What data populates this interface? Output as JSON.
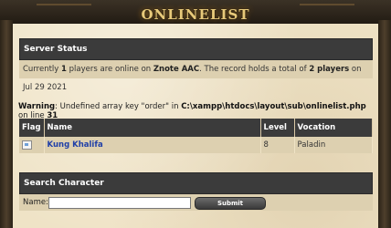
{
  "window": {
    "title": "ONLINELIST"
  },
  "server_status": {
    "heading": "Server Status",
    "text_1": "Currently ",
    "players_count": "1",
    "text_2": " players are online on ",
    "server_name": "Znote AAC",
    "text_3": ". The record holds a total of ",
    "record": "2 players",
    "text_4": " on Jul 29 2021"
  },
  "warning": {
    "label": "Warning",
    "text_1": ": Undefined array key \"order\" in ",
    "path": "C:\\xampp\\htdocs\\layout\\sub\\onlinelist.php",
    "text_2": " on line ",
    "line": "31"
  },
  "online_table": {
    "headers": [
      "Flag",
      "Name",
      "Level",
      "Vocation"
    ],
    "rows": [
      {
        "name": "Kung Khalifa",
        "level": "8",
        "vocation": "Paladin"
      }
    ]
  },
  "search": {
    "heading": "Search Character",
    "label": "Name:",
    "input_value": "",
    "submit_label": "Submit"
  }
}
